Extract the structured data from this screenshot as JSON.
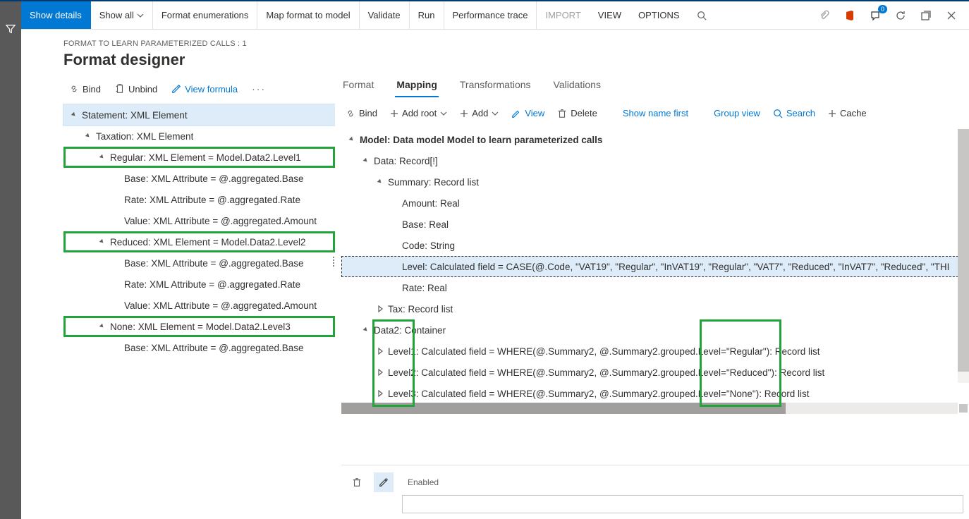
{
  "cmdbar": {
    "show_details": "Show details",
    "show_all": "Show all",
    "format_enum": "Format enumerations",
    "map_format": "Map format to model",
    "validate": "Validate",
    "run": "Run",
    "perf_trace": "Performance trace",
    "import": "IMPORT",
    "view": "VIEW",
    "options": "OPTIONS",
    "badge_count": "0"
  },
  "breadcrumb": "FORMAT TO LEARN PARAMETERIZED CALLS : 1",
  "page_title": "Format designer",
  "left_toolbar": {
    "bind": "Bind",
    "unbind": "Unbind",
    "view_formula": "View formula"
  },
  "left_tree": {
    "n0": "Statement: XML Element",
    "n1": "Taxation: XML Element",
    "n2": "Regular: XML Element = Model.Data2.Level1",
    "n2a": "Base: XML Attribute = @.aggregated.Base",
    "n2b": "Rate: XML Attribute = @.aggregated.Rate",
    "n2c": "Value: XML Attribute = @.aggregated.Amount",
    "n3": "Reduced: XML Element = Model.Data2.Level2",
    "n3a": "Base: XML Attribute = @.aggregated.Base",
    "n3b": "Rate: XML Attribute = @.aggregated.Rate",
    "n3c": "Value: XML Attribute = @.aggregated.Amount",
    "n4": "None: XML Element = Model.Data2.Level3",
    "n4a": "Base: XML Attribute = @.aggregated.Base"
  },
  "right_tabs": {
    "format": "Format",
    "mapping": "Mapping",
    "transformations": "Transformations",
    "validations": "Validations"
  },
  "right_toolbar": {
    "bind": "Bind",
    "add_root": "Add root",
    "add": "Add",
    "view": "View",
    "delete": "Delete",
    "show_name_first": "Show name first",
    "group_view": "Group view",
    "search": "Search",
    "cache": "Cache"
  },
  "right_tree": {
    "m0": "Model: Data model Model to learn parameterized calls",
    "m1": "Data: Record[!]",
    "m2": "Summary: Record list",
    "m2a": "Amount: Real",
    "m2b": "Base: Real",
    "m2c": "Code: String",
    "m2d": "Level: Calculated field = CASE(@.Code, \"VAT19\", \"Regular\", \"InVAT19\", \"Regular\", \"VAT7\", \"Reduced\", \"InVAT7\", \"Reduced\", \"THI",
    "m2e": "Rate: Real",
    "m3": "Tax: Record list",
    "m4": "Data2: Container",
    "m4a": "Level1: Calculated field = WHERE(@.Summary2, @.Summary2.grouped.Level=\"Regular\"): Record list",
    "m4b": "Level2: Calculated field = WHERE(@.Summary2, @.Summary2.grouped.Level=\"Reduced\"): Record list",
    "m4c": "Level3: Calculated field = WHERE(@.Summary2, @.Summary2.grouped.Level=\"None\"): Record list"
  },
  "bottom": {
    "enabled_label": "Enabled",
    "enabled_value": ""
  }
}
